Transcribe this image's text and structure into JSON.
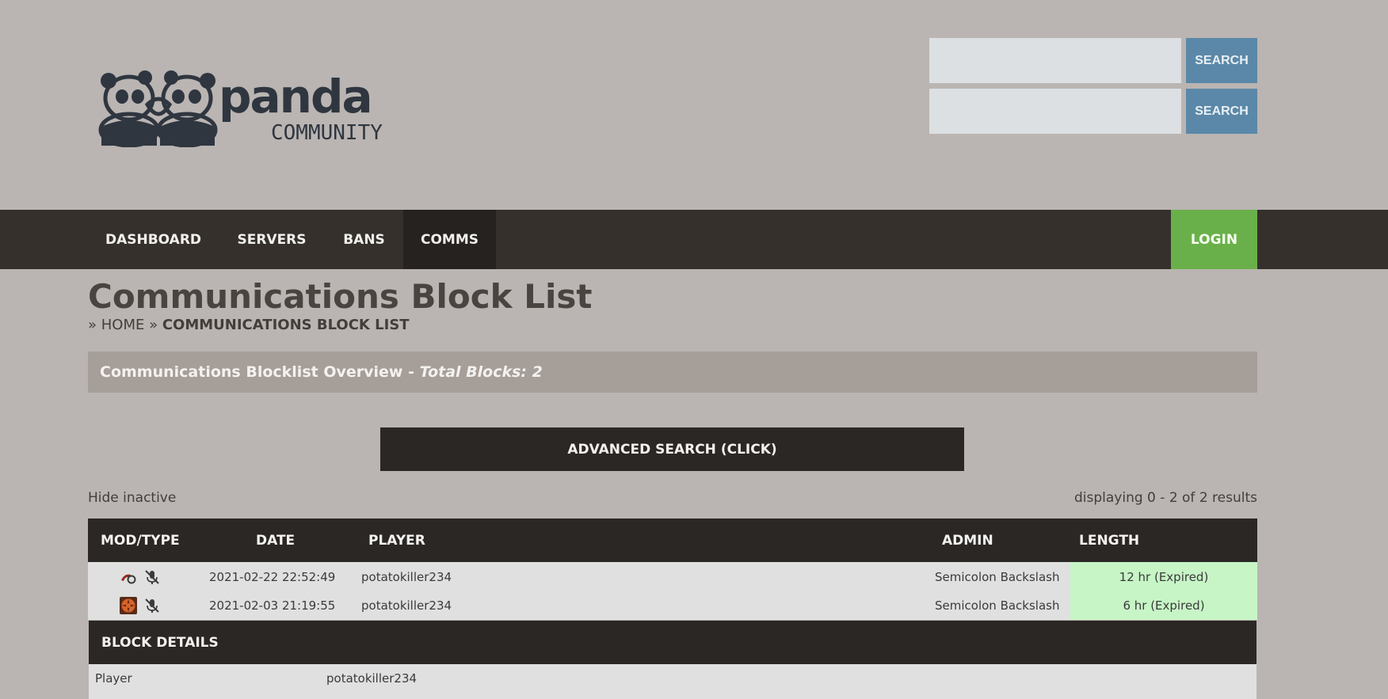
{
  "logo": {
    "name": "panda",
    "subtitle": "COMMUNITY"
  },
  "search": [
    {
      "placeholder": "",
      "button": "SEARCH"
    },
    {
      "placeholder": "",
      "button": "SEARCH"
    }
  ],
  "nav": {
    "items": [
      {
        "label": "DASHBOARD",
        "active": false
      },
      {
        "label": "SERVERS",
        "active": false
      },
      {
        "label": "BANS",
        "active": false
      },
      {
        "label": "COMMS",
        "active": true
      }
    ],
    "login": "LOGIN"
  },
  "page": {
    "title": "Communications Block List",
    "breadcrumb": {
      "sep": "»",
      "home": "HOME",
      "current": "COMMUNICATIONS BLOCK LIST"
    }
  },
  "overview": {
    "label": "Communications Blocklist Overview - ",
    "total": "Total Blocks: 2"
  },
  "advanced_search": "ADVANCED SEARCH (CLICK)",
  "filters": {
    "hide_inactive": "Hide inactive",
    "results": "displaying 0 - 2 of 2 results"
  },
  "table": {
    "headers": {
      "mod_type": "MOD/TYPE",
      "date": "DATE",
      "player": "PLAYER",
      "admin": "ADMIN",
      "length": "LENGTH"
    },
    "rows": [
      {
        "mod_icon": "game-mod-icon",
        "type_icon": "muted-microphone-icon",
        "date": "2021-02-22 22:52:49",
        "player": "potatokiller234",
        "admin": "Semicolon Backslash",
        "length": "12 hr (Expired)"
      },
      {
        "mod_icon": "tf2-mod-icon",
        "type_icon": "muted-microphone-icon",
        "date": "2021-02-03 21:19:55",
        "player": "potatokiller234",
        "admin": "Semicolon Backslash",
        "length": "6 hr (Expired)"
      }
    ]
  },
  "block_details": {
    "title": "BLOCK DETAILS",
    "rows": [
      {
        "label": "Player",
        "value": "potatokiller234"
      }
    ]
  },
  "colors": {
    "nav": "#35302b",
    "login": "#6ab04a",
    "search_button": "#5b88a8",
    "expired": "#c7f5c6"
  }
}
